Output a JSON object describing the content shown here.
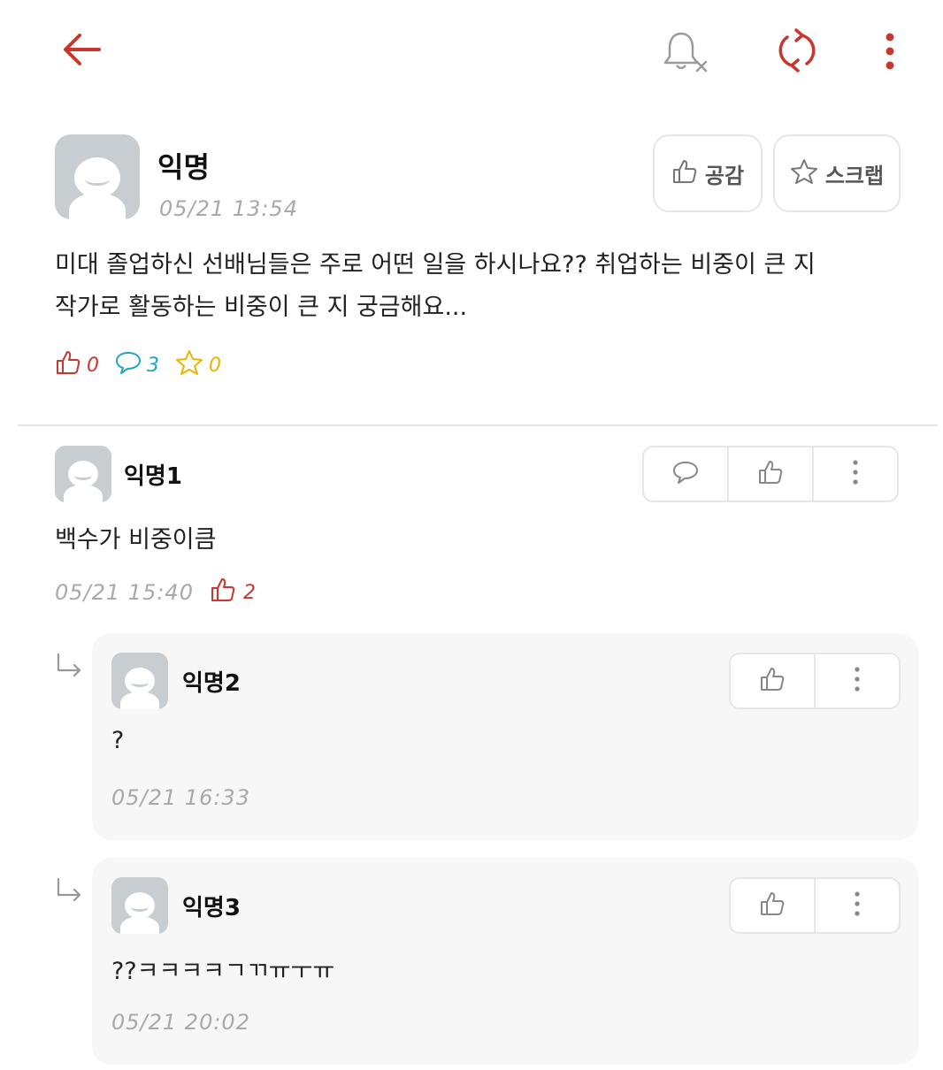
{
  "topbar": {
    "icons": [
      "back-arrow-icon",
      "notification-off-icon",
      "refresh-icon",
      "more-vertical-icon"
    ],
    "accent_color": "#c8372d"
  },
  "post": {
    "author": "익명",
    "time": "05/21 13:54",
    "like_button_label": "공감",
    "scrap_button_label": "스크랩",
    "body_line1": "미대 졸업하신 선배님들은 주로 어떤 일을 하시나요?? 취업하는 비중이 큰 지",
    "body_line2": "작가로 활동하는 비중이 큰 지 궁금해요...",
    "like_count": "0",
    "comment_count": "3",
    "scrap_count": "0",
    "colors": {
      "like": "#c8372d",
      "comment": "#1da7b7",
      "scrap": "#e8b600"
    }
  },
  "comments": [
    {
      "author": "익명1",
      "body": "백수가 비중이큼",
      "time": "05/21 15:40",
      "likes": "2"
    }
  ],
  "replies": [
    {
      "author": "익명2",
      "body": "?",
      "time": "05/21 16:33"
    },
    {
      "author": "익명3",
      "body": "??ㅋㅋㅋㅋㄱㄲㅠㅜㅠ",
      "time": "05/21 20:02"
    }
  ]
}
